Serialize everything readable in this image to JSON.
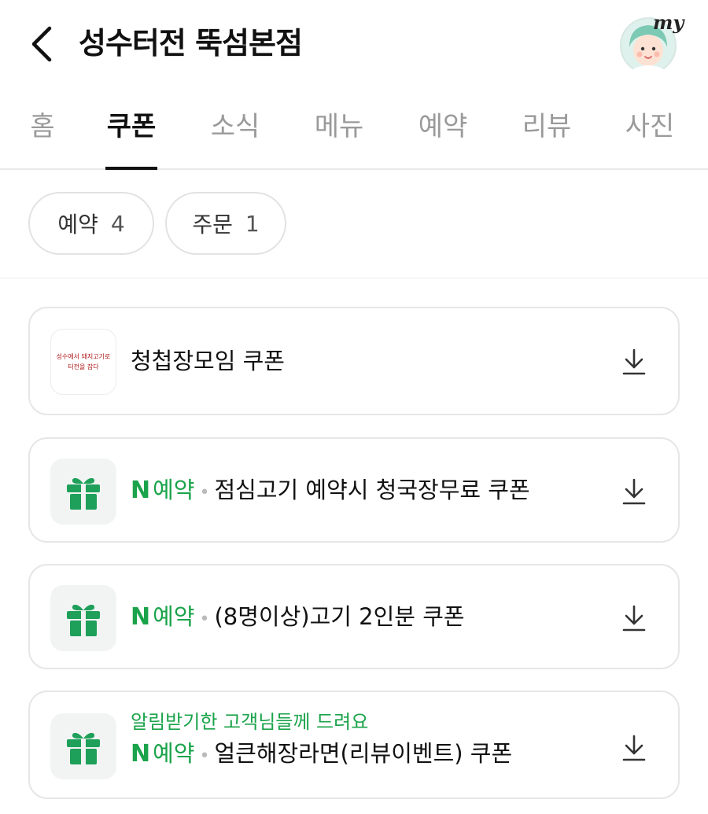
{
  "header": {
    "title": "성수터전 뚝섬본점",
    "back_icon": "chevron-left-icon",
    "avatar_label": "my"
  },
  "tabs": [
    {
      "label": "홈",
      "active": false
    },
    {
      "label": "쿠폰",
      "active": true
    },
    {
      "label": "소식",
      "active": false
    },
    {
      "label": "메뉴",
      "active": false
    },
    {
      "label": "예약",
      "active": false
    },
    {
      "label": "리뷰",
      "active": false
    },
    {
      "label": "사진",
      "active": false
    }
  ],
  "filters": [
    {
      "label": "예약",
      "count": "4"
    },
    {
      "label": "주문",
      "count": "1"
    }
  ],
  "coupons": [
    {
      "type": "logo",
      "source": "",
      "subtitle": "",
      "name": "청첩장모임 쿠폰",
      "logo_text_line1": "성수에서 돼지고기로",
      "logo_text_line2": "터전을 잡다"
    },
    {
      "type": "gift",
      "source_n": "N",
      "source": "예약",
      "subtitle": "",
      "name": "점심고기 예약시 청국장무료 쿠폰"
    },
    {
      "type": "gift",
      "source_n": "N",
      "source": "예약",
      "subtitle": "",
      "name": "(8명이상)고기 2인분 쿠폰"
    },
    {
      "type": "gift",
      "source_n": "N",
      "source": "예약",
      "subtitle": "알림받기한 고객님들께 드려요",
      "name": "얼큰해장라면(리뷰이벤트) 쿠폰"
    }
  ],
  "colors": {
    "accent_green": "#1aa34a",
    "gift_green": "#1fa05a",
    "tab_inactive": "#9a9a9a",
    "text_primary": "#111111"
  }
}
